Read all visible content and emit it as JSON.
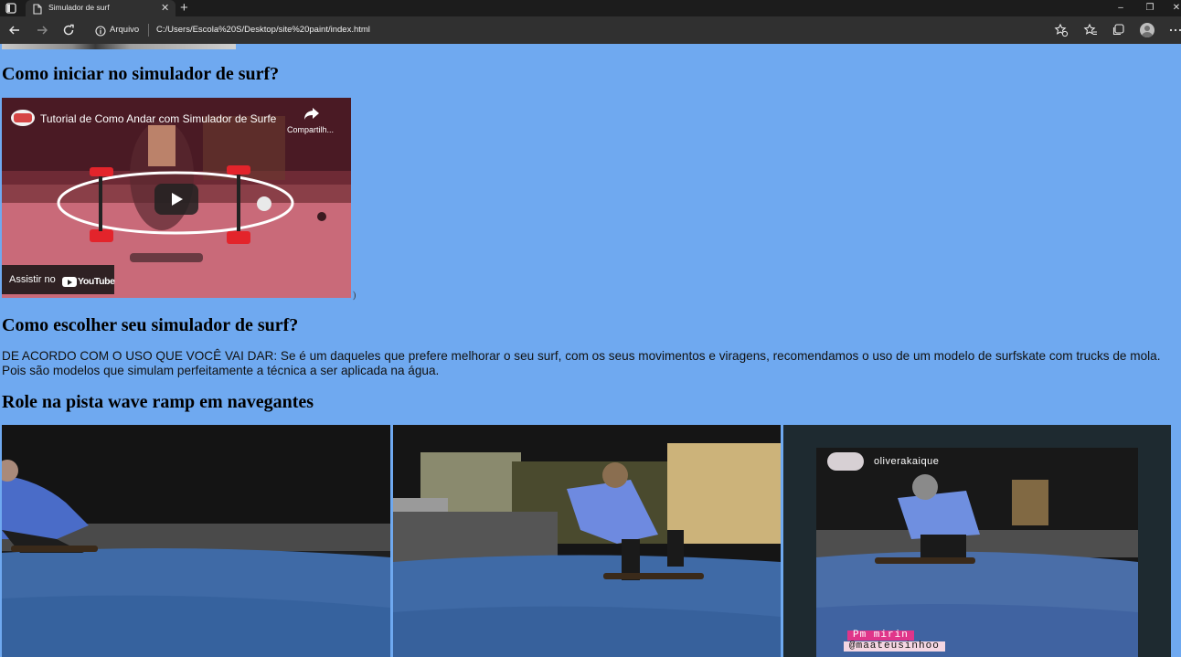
{
  "browser": {
    "tab_title": "Simulador de surf",
    "new_tab_symbol": "+",
    "tab_close_symbol": "✕",
    "site_label": "Arquivo",
    "url": "C:/Users/Escola%20S/Desktop/site%20paint/index.html",
    "window_controls": {
      "minimize": "–",
      "restore": "❐",
      "close": "✕"
    },
    "icons": [
      "sidebar-icon",
      "page-icon",
      "back-icon",
      "forward-icon",
      "refresh-icon",
      "info-icon",
      "favorite-add-icon",
      "favorites-icon",
      "collections-icon",
      "profile-icon",
      "more-icon"
    ]
  },
  "page": {
    "background": "#6fa9f0",
    "heading_start": "Como iniciar no simulador de surf?",
    "video": {
      "title": "Tutorial de Como Andar com Simulador de Surfe",
      "share_label": "Compartilh...",
      "watch_on_label": "Assistir no",
      "youtube_wordmark": "YouTube",
      "stray_char": ")"
    },
    "heading_choose": "Como escolher seu simulador de surf?",
    "paragraph": "DE ACORDO COM O USO QUE VOCÊ VAI DAR: Se é um daqueles que prefere melhorar o seu surf, com os seus movimentos e viragens, recomendamos o uso de um modelo de surfskate com trucks de mola. Pois são modelos que simulam perfeitamente a técnica a ser aplicada na água.",
    "heading_ramp": "Role na pista wave ramp em navegantes",
    "photo3": {
      "story_username": "oliverakaique",
      "tag_1": "Pm mirin",
      "tag_2": "@maateusinhoo"
    }
  }
}
